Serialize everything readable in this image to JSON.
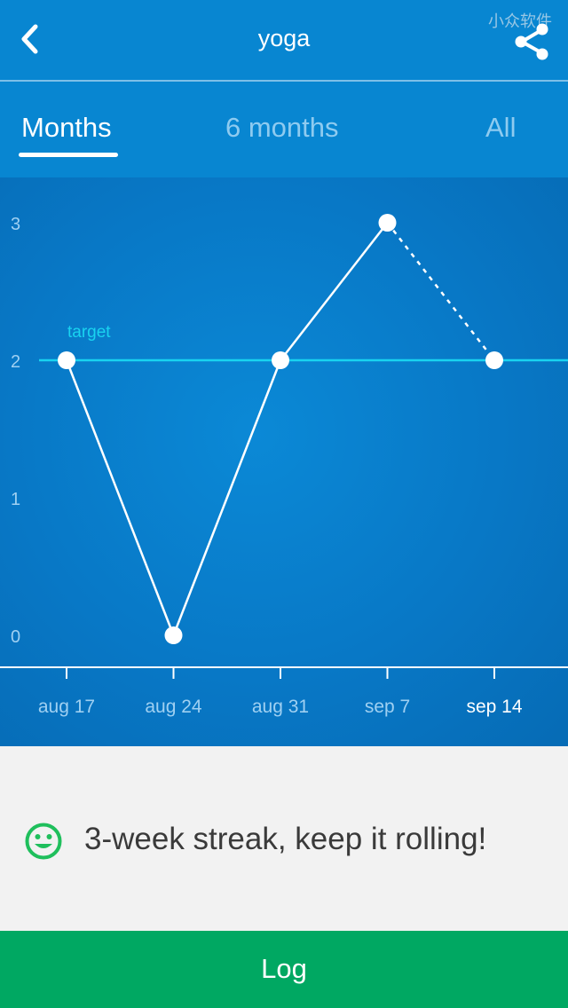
{
  "header": {
    "title": "yoga",
    "watermark": "小众软件",
    "back_icon": "chevron-left-icon",
    "share_icon": "share-icon"
  },
  "tabs": [
    {
      "label": "Months",
      "active": true
    },
    {
      "label": "6 months",
      "active": false
    },
    {
      "label": "All",
      "active": false
    }
  ],
  "chart_data": {
    "type": "line",
    "title": "",
    "xlabel": "",
    "ylabel": "",
    "categories": [
      "aug 17",
      "aug 24",
      "aug 31",
      "sep 7",
      "sep 14"
    ],
    "y_ticks": [
      "0",
      "1",
      "2",
      "3"
    ],
    "ylim": [
      0,
      3
    ],
    "series": [
      {
        "name": "yoga",
        "values": [
          2,
          0,
          2,
          3,
          2
        ],
        "dashed_last_segment": true
      }
    ],
    "target": {
      "label": "target",
      "value": 2
    },
    "highlighted_category": "sep 14",
    "grid": false,
    "colors": {
      "line": "#ffffff",
      "target": "#19d3f0",
      "tick_label": "#9fd0f2",
      "highlight_label": "#ffffff"
    }
  },
  "message": {
    "icon": "smiley-icon",
    "text": "3-week streak, keep it rolling!",
    "icon_color": "#1fbf5c"
  },
  "log_button": {
    "label": "Log",
    "color": "#00a862"
  }
}
